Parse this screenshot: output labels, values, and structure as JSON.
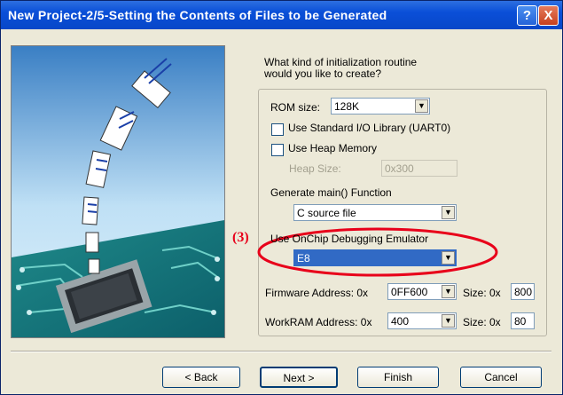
{
  "window": {
    "title": "New Project-2/5-Setting the Contents of Files to be Generated",
    "help_icon": "?",
    "close_icon": "X"
  },
  "question": {
    "line1": "What kind of initialization routine",
    "line2": "would you like to create?"
  },
  "rom": {
    "label": "ROM size:",
    "value": "128K"
  },
  "stdio": {
    "label": "Use Standard I/O Library (UART0)",
    "checked": false
  },
  "heap": {
    "label": "Use Heap Memory",
    "checked": false,
    "size_label": "Heap Size:",
    "size_value": "0x300"
  },
  "main_fn": {
    "label": "Generate main() Function",
    "value": "C source file"
  },
  "debugger": {
    "label": "Use OnChip Debugging Emulator",
    "value": "E8",
    "annotation": "(3)",
    "highlight_color": "#e8001a"
  },
  "firmware": {
    "label": "Firmware Address: 0x",
    "value": "0FF600",
    "size_label": "Size: 0x",
    "size_value": "800"
  },
  "workram": {
    "label": "WorkRAM Address: 0x",
    "value": "400",
    "size_label": "Size: 0x",
    "size_value": "80"
  },
  "buttons": {
    "back": "< Back",
    "next": "Next >",
    "finish": "Finish",
    "cancel": "Cancel"
  }
}
